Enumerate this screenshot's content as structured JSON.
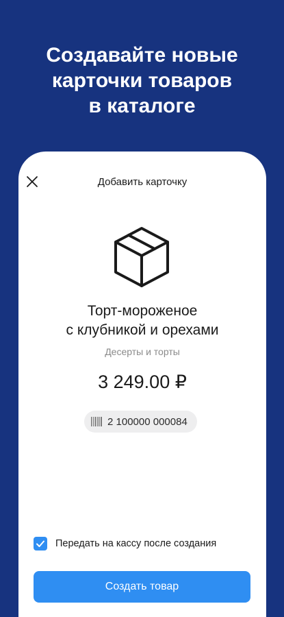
{
  "promo": {
    "headline_lines": [
      "Создавайте новые",
      "карточки товаров",
      "в каталоге"
    ]
  },
  "dialog": {
    "title": "Добавить карточку",
    "close_icon": "close-icon"
  },
  "product": {
    "icon": "box-icon",
    "name_lines": [
      "Торт-мороженое",
      "с клубникой и орехами"
    ],
    "category": "Десерты и торты",
    "price": "3 249.00 ₽",
    "barcode_icon": "barcode-icon",
    "barcode": "2 100000 000084"
  },
  "options": {
    "send_to_register_label": "Передать на кассу после создания",
    "send_to_register_checked": true
  },
  "actions": {
    "create_label": "Создать товар"
  },
  "colors": {
    "background": "#17337f",
    "accent": "#2f8ef2"
  }
}
